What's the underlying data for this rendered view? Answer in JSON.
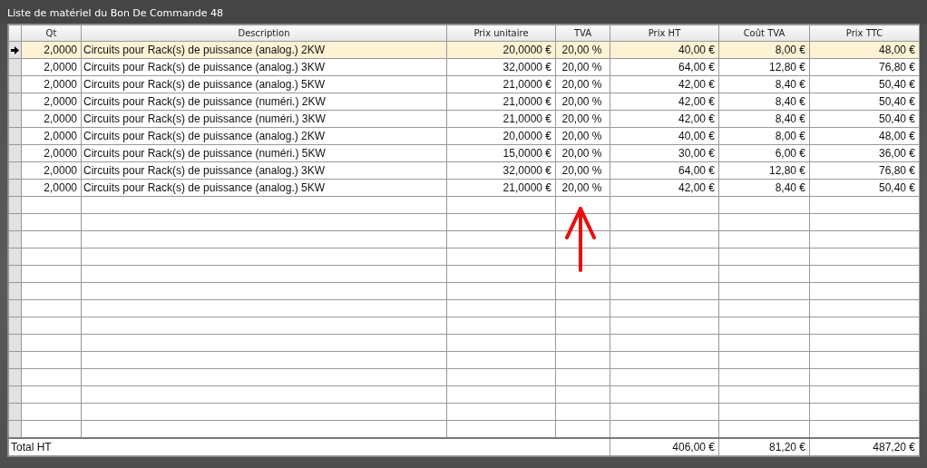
{
  "window": {
    "title": "Liste de matériel du Bon De Commande 48"
  },
  "table": {
    "columns": [
      "Qt",
      "Description",
      "Prix unitaire",
      "TVA",
      "Prix HT",
      "Coût TVA",
      "Prix TTC"
    ],
    "rows": [
      {
        "selected": true,
        "cells": [
          "2,0000",
          "Circuits pour Rack(s) de puissance (analog.) 2KW",
          "20,0000 €",
          "20,00 %",
          "40,00 €",
          "8,00 €",
          "48,00 €"
        ]
      },
      {
        "selected": false,
        "cells": [
          "2,0000",
          "Circuits pour Rack(s) de puissance (analog.) 3KW",
          "32,0000 €",
          "20,00 %",
          "64,00 €",
          "12,80 €",
          "76,80 €"
        ]
      },
      {
        "selected": false,
        "cells": [
          "2,0000",
          "Circuits pour Rack(s) de puissance (analog.) 5KW",
          "21,0000 €",
          "20,00 %",
          "42,00 €",
          "8,40 €",
          "50,40 €"
        ]
      },
      {
        "selected": false,
        "cells": [
          "2,0000",
          "Circuits pour Rack(s) de puissance (numéri.) 2KW",
          "21,0000 €",
          "20,00 %",
          "42,00 €",
          "8,40 €",
          "50,40 €"
        ]
      },
      {
        "selected": false,
        "cells": [
          "2,0000",
          "Circuits pour Rack(s) de puissance (numéri.) 3KW",
          "21,0000 €",
          "20,00 %",
          "42,00 €",
          "8,40 €",
          "50,40 €"
        ]
      },
      {
        "selected": false,
        "cells": [
          "2,0000",
          "Circuits pour Rack(s) de puissance (analog.) 2KW",
          "20,0000 €",
          "20,00 %",
          "40,00 €",
          "8,00 €",
          "48,00 €"
        ]
      },
      {
        "selected": false,
        "cells": [
          "2,0000",
          "Circuits pour Rack(s) de puissance (numéri.) 5KW",
          "15,0000 €",
          "20,00 %",
          "30,00 €",
          "6,00 €",
          "36,00 €"
        ]
      },
      {
        "selected": false,
        "cells": [
          "2,0000",
          "Circuits pour Rack(s) de puissance (analog.) 3KW",
          "32,0000 €",
          "20,00 %",
          "64,00 €",
          "12,80 €",
          "76,80 €"
        ]
      },
      {
        "selected": false,
        "cells": [
          "2,0000",
          "Circuits pour Rack(s) de puissance (analog.) 5KW",
          "21,0000 €",
          "20,00 %",
          "42,00 €",
          "8,40 €",
          "50,40 €"
        ]
      }
    ],
    "total": {
      "label": "Total HT",
      "values": [
        "406,00 €",
        "81,20 €",
        "487,20 €"
      ]
    }
  }
}
